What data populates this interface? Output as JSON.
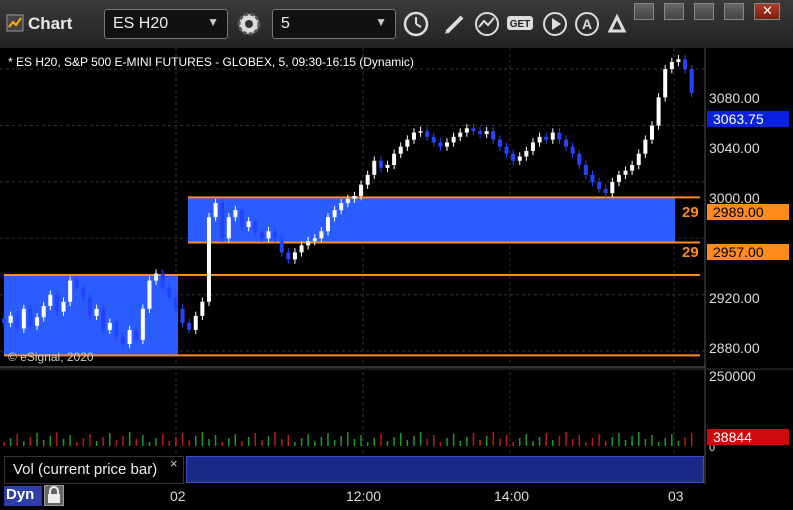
{
  "window": {
    "title": "Chart"
  },
  "toolbar": {
    "symbol": "ES H20",
    "interval": "5",
    "icons": [
      "gear-icon",
      "clock-icon",
      "pencil-icon",
      "chart-line-icon",
      "get-icon",
      "play-icon",
      "alert-icon",
      "settings-icon"
    ]
  },
  "chart": {
    "status_line": "* ES H20, S&P 500 E-MINI FUTURES - GLOBEX, 5, 09:30-16:15 (Dynamic)",
    "copyright": "© eSignal, 2020",
    "y_ticks": [
      "3080.00",
      "3040.00",
      "3000.00",
      "2920.00",
      "2880.00"
    ],
    "last_price": "3063.75",
    "level_upper": "2989.00",
    "level_lower": "2957.00",
    "level_upper_left": "29",
    "level_lower_left": "29",
    "x_ticks": [
      "02",
      "12:00",
      "14:00",
      "03"
    ],
    "colors": {
      "up": "#ffffff",
      "down": "#2244ff",
      "zone": "#2a5cff",
      "level": "#ff8c1a",
      "last": "#0a22e0"
    }
  },
  "volume": {
    "label": "Vol (current price bar)",
    "close": "×",
    "max_tick": "250000",
    "zero_tick": "0",
    "current": "38844"
  },
  "footer": {
    "dyn": "Dyn"
  },
  "chart_data": {
    "type": "candlestick",
    "ylim": [
      2868,
      3095
    ],
    "zones": [
      {
        "x_from": 0,
        "x_to": 35,
        "y_low": 2877,
        "y_high": 2934
      },
      {
        "x_from": 37,
        "x_to": 135,
        "y_low": 2957,
        "y_high": 2989
      }
    ],
    "bars_close": [
      2900,
      2905,
      2896,
      2910,
      2898,
      2904,
      2912,
      2920,
      2908,
      2915,
      2930,
      2925,
      2918,
      2905,
      2910,
      2895,
      2900,
      2890,
      2885,
      2895,
      2888,
      2910,
      2930,
      2935,
      2925,
      2918,
      2910,
      2900,
      2895,
      2905,
      2915,
      2975,
      2985,
      2960,
      2975,
      2980,
      2968,
      2972,
      2965,
      2960,
      2965,
      2960,
      2950,
      2945,
      2950,
      2955,
      2958,
      2960,
      2965,
      2975,
      2980,
      2985,
      2988,
      2990,
      2998,
      3005,
      3015,
      3010,
      3012,
      3020,
      3025,
      3030,
      3035,
      3036,
      3032,
      3028,
      3025,
      3028,
      3032,
      3035,
      3038,
      3036,
      3034,
      3036,
      3030,
      3025,
      3020,
      3015,
      3018,
      3022,
      3028,
      3032,
      3030,
      3035,
      3030,
      3025,
      3020,
      3012,
      3005,
      3000,
      2995,
      2992,
      3000,
      3005,
      3008,
      3012,
      3020,
      3030,
      3040,
      3060,
      3080,
      3085,
      3087,
      3080,
      3063
    ]
  }
}
